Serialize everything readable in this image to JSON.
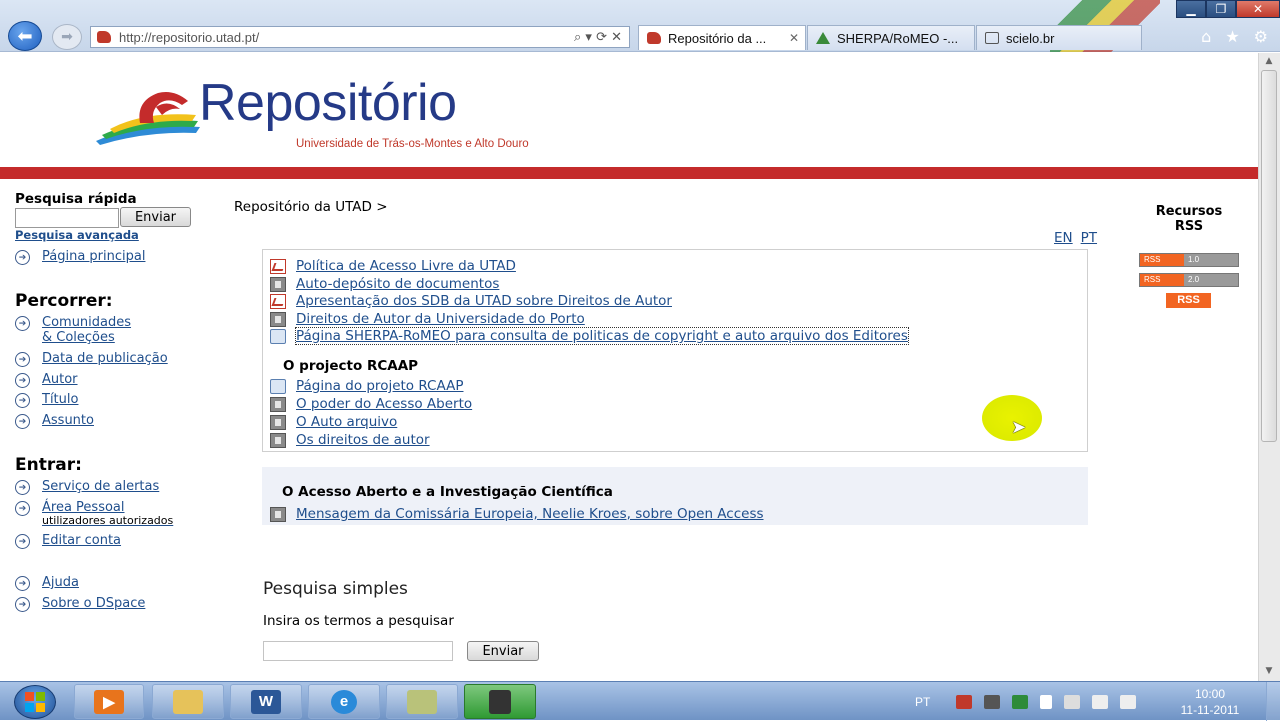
{
  "browser": {
    "url": "http://repositorio.utad.pt/",
    "address_controls": "⌕ ▾ ⟳ ✕",
    "tabs": [
      {
        "label": "Repositório da ...",
        "active": true
      },
      {
        "label": "SHERPA/RoMEO -...",
        "active": false
      },
      {
        "label": "scielo.br",
        "active": false
      }
    ],
    "window_controls": [
      "minimize-icon",
      "restore-icon",
      "close-icon"
    ],
    "toolbar_icons": [
      "home-icon",
      "favorites-star-icon",
      "gear-icon"
    ]
  },
  "site": {
    "logo_title": "Repositório",
    "logo_subtitle": "Universidade de Trás-os-Montes e Alto Douro",
    "brand_colors": {
      "title": "#253a87",
      "bar": "#c42b2b",
      "link": "#1f4e8c"
    }
  },
  "sidebar": {
    "quick_search_label": "Pesquisa rápida",
    "quick_search_button": "Enviar",
    "advanced_search": "Pesquisa avançada",
    "home_link": "Página principal",
    "browse_heading": "Percorrer:",
    "browse_items": [
      {
        "label": "Comunidades",
        "label2": "& Coleções"
      },
      {
        "label": "Data de publicação"
      },
      {
        "label": "Autor"
      },
      {
        "label": "Título"
      },
      {
        "label": "Assunto"
      }
    ],
    "login_heading": "Entrar:",
    "login_items": [
      {
        "label": "Serviço de alertas"
      },
      {
        "label": "Área Pessoal",
        "sub": "utilizadores autorizados"
      },
      {
        "label": "Editar conta"
      }
    ],
    "help_items": [
      {
        "label": "Ajuda"
      },
      {
        "label": "Sobre o DSpace"
      }
    ]
  },
  "main": {
    "breadcrumb": "Repositório da UTAD >",
    "languages": [
      "EN",
      "PT"
    ],
    "documents": [
      {
        "label": "Política de Acesso Livre da UTAD",
        "icon": "pdf-icon"
      },
      {
        "label": "Auto-depósito de documentos",
        "icon": "video-icon"
      },
      {
        "label": "Apresentação dos SDB da UTAD sobre Direitos de Autor",
        "icon": "pdf-icon"
      },
      {
        "label": "Direitos de Autor da Universidade do Porto",
        "icon": "video-icon"
      },
      {
        "label": "Página SHERPA-RoMEO para consulta de politicas de copyright e auto arquivo dos Editores",
        "icon": "web-page-icon"
      }
    ],
    "rcaap_heading": "O projecto RCAAP",
    "rcaap_items": [
      {
        "label": "Página do projeto RCAAP",
        "icon": "web-page-icon"
      },
      {
        "label": "O poder do Acesso Aberto",
        "icon": "video-icon"
      },
      {
        "label": "O Auto arquivo",
        "icon": "video-icon"
      },
      {
        "label": "Os direitos de autor",
        "icon": "video-icon"
      }
    ],
    "oa_heading": "O Acesso Aberto e a Investigação Científica",
    "oa_items": [
      {
        "label": "Mensagem da Comissária Europeia, Neelie Kroes, sobre Open Access",
        "icon": "video-icon"
      }
    ],
    "simple_search_title": "Pesquisa simples",
    "simple_search_label": "Insira os termos a pesquisar",
    "simple_search_button": "Enviar"
  },
  "rss": {
    "title_line1": "Recursos",
    "title_line2": "RSS",
    "badges": [
      {
        "left": "RSS",
        "right": "1.0"
      },
      {
        "left": "RSS",
        "right": "2.0"
      }
    ],
    "big_badge": "RSS"
  },
  "taskbar": {
    "apps": [
      {
        "name": "media-player-icon",
        "color": "#e8741c"
      },
      {
        "name": "file-explorer-icon",
        "color": "#e6c25a"
      },
      {
        "name": "word-icon",
        "letter": "W",
        "color": "#2b5797"
      },
      {
        "name": "internet-explorer-icon",
        "letter": "e",
        "color": "#2a8ad9"
      },
      {
        "name": "notes-icon",
        "color": "#b9c27a"
      },
      {
        "name": "video-recorder-icon",
        "color": "#333333",
        "active": true
      }
    ],
    "language": "PT",
    "clock_time": "10:00",
    "clock_date": "11-11-2011"
  }
}
